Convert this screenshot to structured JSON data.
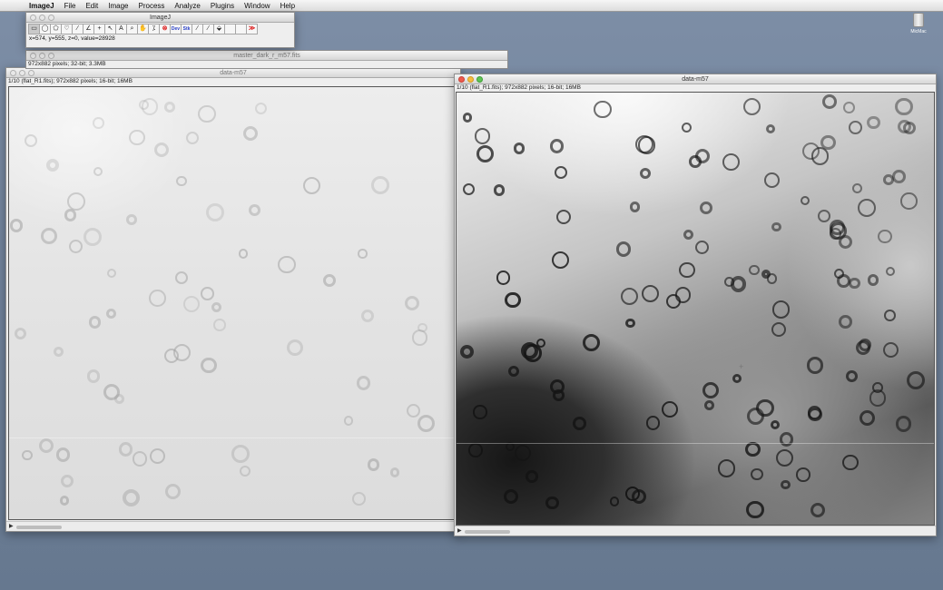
{
  "menubar": {
    "apple_glyph": "",
    "items": [
      "ImageJ",
      "File",
      "Edit",
      "Image",
      "Process",
      "Analyze",
      "Plugins",
      "Window",
      "Help"
    ]
  },
  "desktop": {
    "drive_label": "MicMac"
  },
  "imagej_window": {
    "title": "ImageJ",
    "tools": [
      {
        "name": "rectangle-tool",
        "glyph": "▭",
        "selected": true
      },
      {
        "name": "oval-tool",
        "glyph": "◯"
      },
      {
        "name": "polygon-tool",
        "glyph": "⬠"
      },
      {
        "name": "freehand-tool",
        "glyph": "♡"
      },
      {
        "name": "line-tool",
        "glyph": "⁄"
      },
      {
        "name": "angle-tool",
        "glyph": "∠"
      },
      {
        "name": "point-tool",
        "glyph": "+"
      },
      {
        "name": "wand-tool",
        "glyph": "↖"
      },
      {
        "name": "text-tool",
        "glyph": "A"
      },
      {
        "name": "magnifier-tool",
        "glyph": "⌕"
      },
      {
        "name": "hand-tool",
        "glyph": "✋"
      },
      {
        "name": "dropper-tool",
        "glyph": "⁒"
      },
      {
        "name": "stop-tool",
        "glyph": "⊗",
        "red": true
      },
      {
        "name": "dev-tool",
        "glyph": "Dev",
        "blue": true
      },
      {
        "name": "stk-tool",
        "glyph": "Stk",
        "blue": true
      },
      {
        "name": "brush-tool",
        "glyph": "⁄"
      },
      {
        "name": "pencil-tool",
        "glyph": "⁄"
      },
      {
        "name": "flood-fill-tool",
        "glyph": "⬙"
      },
      {
        "name": "blank-tool-1",
        "glyph": ""
      },
      {
        "name": "blank-tool-2",
        "glyph": ""
      },
      {
        "name": "more-tools",
        "glyph": "≫",
        "red": true
      }
    ],
    "status": "x=574, y=555, z=0, value=28928"
  },
  "dark_window": {
    "title": "master_dark_r_m57.fits",
    "info": "972x882 pixels; 32-bit; 3.3MB"
  },
  "left_window": {
    "title": "data-m57",
    "info": "1/10 (flat_R1.fits); 972x882 pixels; 16-bit; 16MB"
  },
  "right_window": {
    "title": "data-m57",
    "info": "1/10 (flat_R1.fits); 972x882 pixels; 16-bit; 16MB"
  },
  "playback": {
    "arrow_glyph": "▶"
  },
  "colors": {
    "desktop": "#6e8099",
    "close": "#ee5b4c",
    "minimize": "#f5bd3f",
    "zoom": "#5fc455"
  }
}
